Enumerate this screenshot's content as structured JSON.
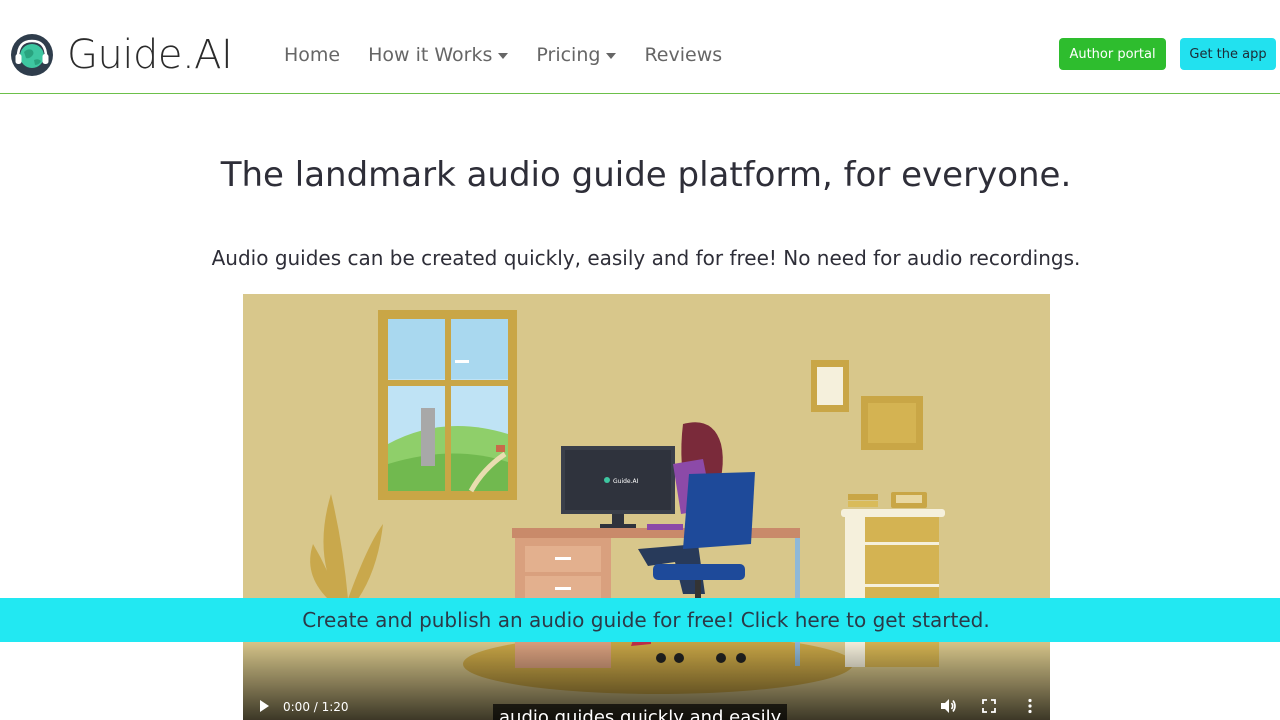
{
  "brand": {
    "name": "Guide.AI"
  },
  "nav": {
    "items": [
      {
        "label": "Home",
        "dropdown": false
      },
      {
        "label": "How it Works",
        "dropdown": true
      },
      {
        "label": "Pricing",
        "dropdown": true
      },
      {
        "label": "Reviews",
        "dropdown": false
      }
    ],
    "author_portal": "Author portal",
    "get_app": "Get the app"
  },
  "hero": {
    "title": "The landmark audio guide platform, for everyone.",
    "subtitle": "Audio guides can be created quickly, easily and for free! No need for audio recordings."
  },
  "video": {
    "screen_logo": "Guide.AI",
    "time": "0:00 / 1:20",
    "caption": "audio guides quickly and easily"
  },
  "banner": {
    "text": "Create and publish an audio guide for free! Click here to get started."
  },
  "colors": {
    "accent_green": "#2ebd2e",
    "accent_cyan": "#22e1ef",
    "navbar_border": "#6cc04a",
    "banner_bg": "#22e8f2"
  },
  "icons": [
    "headphones-globe-icon",
    "chevron-down-icon",
    "play-icon",
    "volume-icon",
    "fullscreen-icon",
    "more-vertical-icon"
  ]
}
